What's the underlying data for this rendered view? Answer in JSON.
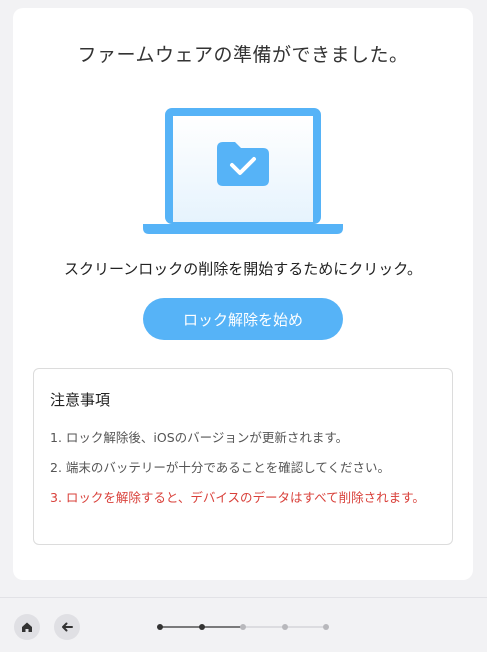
{
  "main": {
    "title": "ファームウェアの準備ができました。",
    "subtitle": "スクリーンロックの削除を開始するためにクリック。",
    "unlock_button_label": "ロック解除を始め"
  },
  "notice": {
    "title": "注意事項",
    "items": [
      "1. ロック解除後、iOSのバージョンが更新されます。",
      "2. 端末のバッテリーが十分であることを確認してください。",
      "3. ロックを解除すると、デバイスのデータはすべて削除されます。"
    ]
  },
  "footer": {
    "home_icon": "home-icon",
    "back_icon": "arrow-left-icon",
    "steps_total": 5,
    "step_current": 2
  },
  "colors": {
    "accent": "#56b3f7",
    "warning": "#d9403a"
  }
}
